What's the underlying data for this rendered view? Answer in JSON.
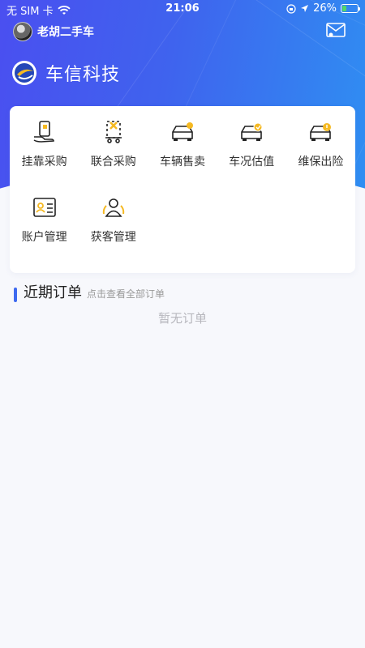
{
  "status_bar": {
    "carrier": "无 SIM 卡",
    "time": "21:06",
    "battery": "26%",
    "battery_level": 0.26
  },
  "user": {
    "name": "老胡二手车"
  },
  "brand": {
    "title": "车信科技"
  },
  "menu": [
    {
      "label": "挂靠采购",
      "icon": "hand-phone-icon"
    },
    {
      "label": "联合采购",
      "icon": "cart-icon"
    },
    {
      "label": "车辆售卖",
      "icon": "car-sell-icon"
    },
    {
      "label": "车况估值",
      "icon": "car-value-icon"
    },
    {
      "label": "维保出险",
      "icon": "car-insurance-icon"
    },
    {
      "label": "账户管理",
      "icon": "id-card-icon"
    },
    {
      "label": "获客管理",
      "icon": "customers-icon"
    }
  ],
  "recent_orders": {
    "title": "近期订单",
    "view_all": "点击查看全部订单",
    "empty_text": "暂无订单"
  },
  "colors": {
    "accent": "#3e6af0",
    "highlight": "#f5b922"
  }
}
